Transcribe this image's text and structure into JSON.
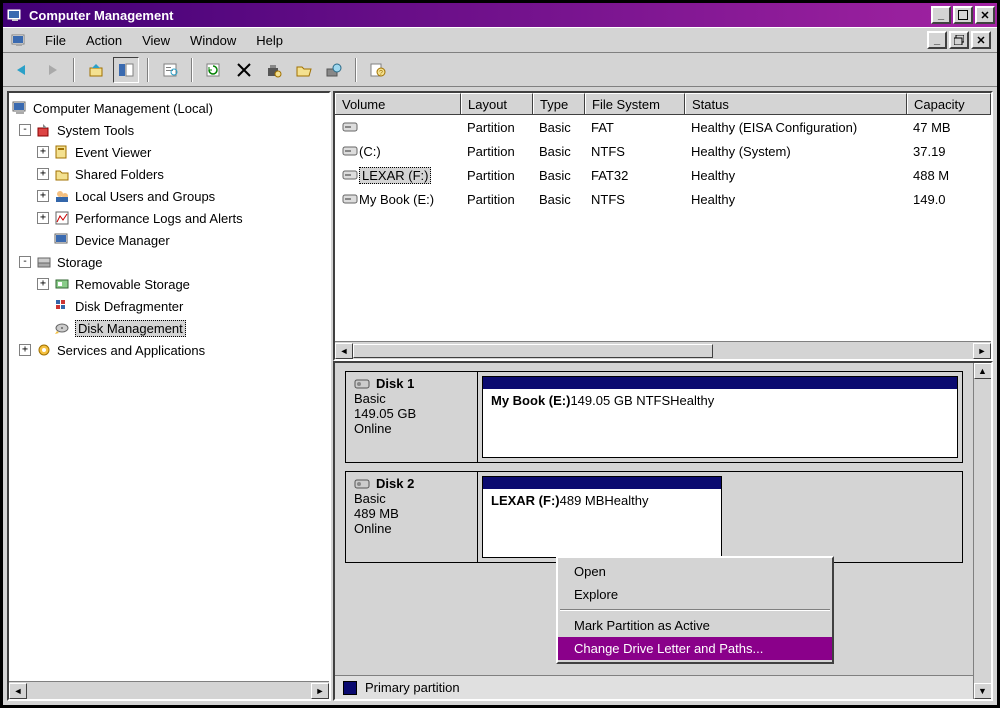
{
  "window": {
    "title": "Computer Management"
  },
  "menubar": [
    "File",
    "Action",
    "View",
    "Window",
    "Help"
  ],
  "tree": {
    "root": "Computer Management (Local)",
    "sys": "System Tools",
    "sys_items": [
      "Event Viewer",
      "Shared Folders",
      "Local Users and Groups",
      "Performance Logs and Alerts",
      "Device Manager"
    ],
    "storage": "Storage",
    "storage_items": [
      "Removable Storage",
      "Disk Defragmenter",
      "Disk Management"
    ],
    "services": "Services and Applications"
  },
  "volumes": {
    "headers": [
      "Volume",
      "Layout",
      "Type",
      "File System",
      "Status",
      "Capacity"
    ],
    "rows": [
      {
        "name": "",
        "layout": "Partition",
        "type": "Basic",
        "fs": "FAT",
        "status": "Healthy (EISA Configuration)",
        "cap": "47 MB"
      },
      {
        "name": "(C:)",
        "layout": "Partition",
        "type": "Basic",
        "fs": "NTFS",
        "status": "Healthy (System)",
        "cap": "37.19"
      },
      {
        "name": "LEXAR (F:)",
        "layout": "Partition",
        "type": "Basic",
        "fs": "FAT32",
        "status": "Healthy",
        "cap": "488 M",
        "selected": true
      },
      {
        "name": "My Book (E:)",
        "layout": "Partition",
        "type": "Basic",
        "fs": "NTFS",
        "status": "Healthy",
        "cap": "149.0"
      }
    ]
  },
  "disks": [
    {
      "label": "Disk 1",
      "type": "Basic",
      "size": "149.05 GB",
      "status": "Online",
      "part": {
        "name": "My Book  (E:)",
        "detail": "149.05 GB NTFS",
        "health": "Healthy"
      }
    },
    {
      "label": "Disk 2",
      "type": "Basic",
      "size": "489 MB",
      "status": "Online",
      "part": {
        "name": "LEXAR  (F:)",
        "detail": "489 MB",
        "health": "Healthy"
      },
      "selected": true
    }
  ],
  "legend": {
    "primary": "Primary partition"
  },
  "context_menu": [
    "Open",
    "Explore",
    "—",
    "Mark Partition as Active",
    "Change Drive Letter and Paths..."
  ]
}
